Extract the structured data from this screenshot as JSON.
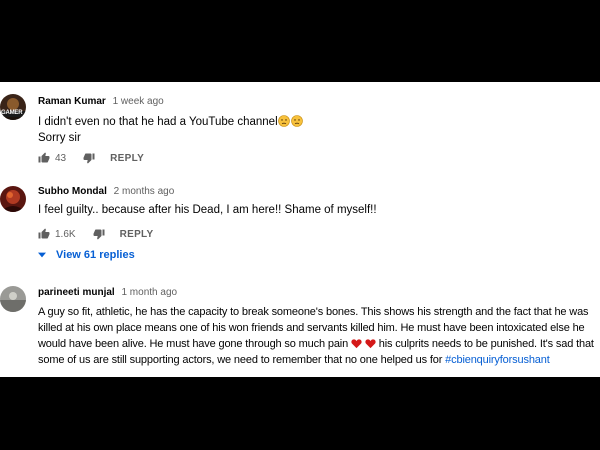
{
  "comments": [
    {
      "author": "Raman Kumar",
      "time": "1 week ago",
      "line1": "I didn't even  no that he had a YouTube channel",
      "line2": "Sorry sir",
      "likes": "43",
      "reply_label": "REPLY",
      "avatar_text": "GAMER",
      "emoji": "disappointed-face"
    },
    {
      "author": "Subho Mondal",
      "time": "2 months ago",
      "text": "I feel guilty.. because after his Dead, I am here!! Shame of myself!!",
      "likes": "1.6K",
      "reply_label": "REPLY",
      "view_replies": "View 61 replies"
    },
    {
      "author": "parineeti munjal",
      "time": "1 month ago",
      "text_before": "A guy so fit, athletic, he has the capacity to break someone's bones. This shows his strength and the fact that he was killed at his own place means one of his won friends and servants killed him. He must have been intoxicated else he would have been alive. He must have gone through so much pain ",
      "text_after": " his culprits needs to be punished. It's sad that some of us are still supporting actors, we need to remember that no one helped us for ",
      "hashtag": "#cbienquiryforsushant",
      "emoji": "red-heart"
    }
  ],
  "colors": {
    "background": "#000000",
    "panel": "#ffffff",
    "text": "#030303",
    "meta": "#606060",
    "link": "#065fd4"
  }
}
